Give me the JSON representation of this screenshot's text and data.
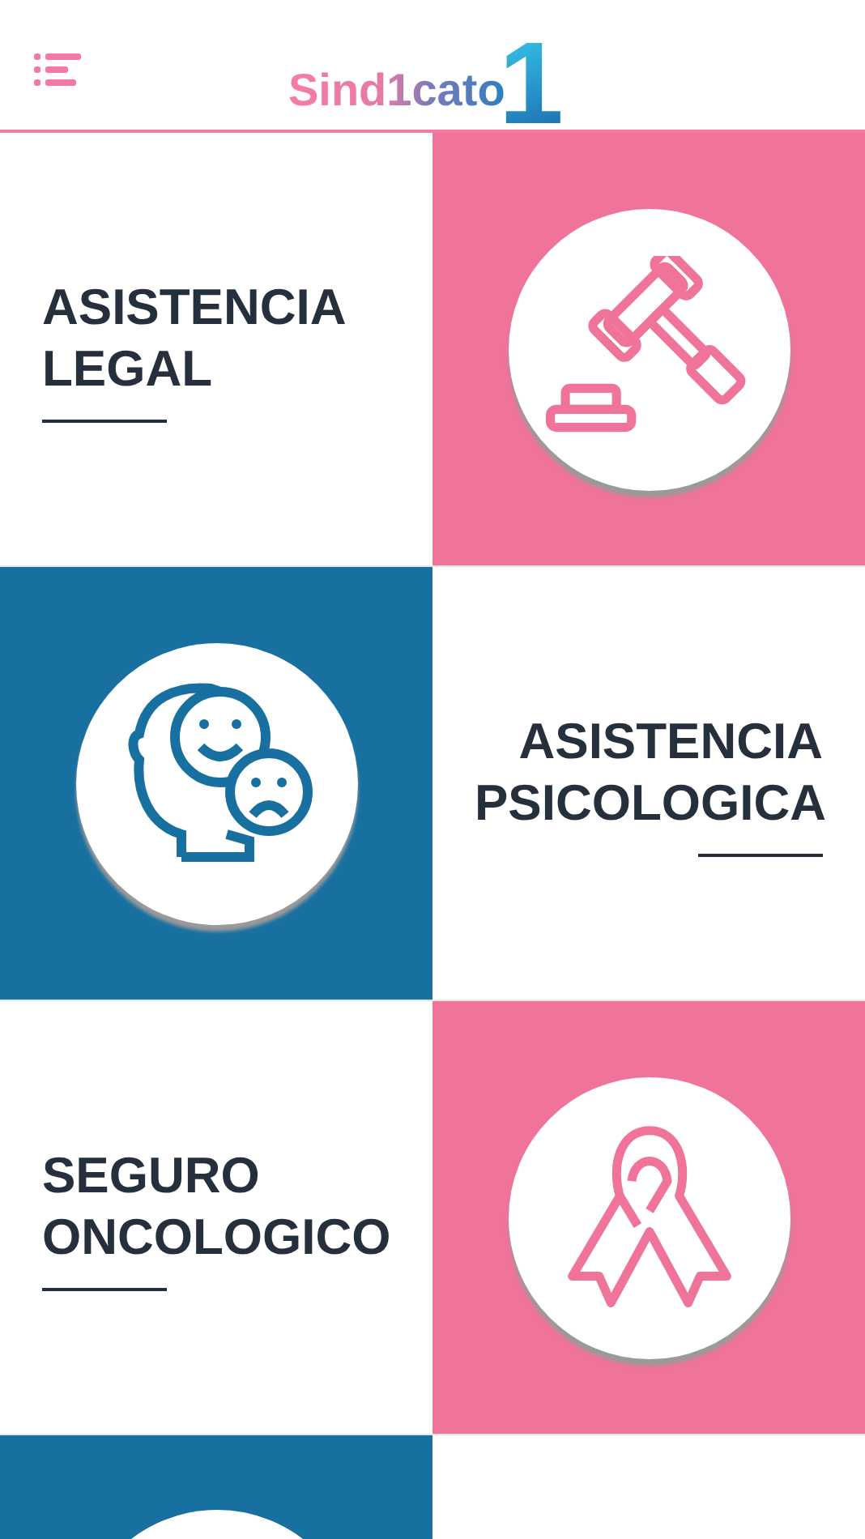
{
  "header": {
    "logo_text": "Sind1cato",
    "logo_mark": "1"
  },
  "sections": [
    {
      "title": "ASISTENCIA LEGAL",
      "text_left": true,
      "color": "#f07399",
      "kind": "gavel"
    },
    {
      "title": "ASISTENCIA PSICOLOGICA",
      "text_left": false,
      "color": "#17709f",
      "kind": "head"
    },
    {
      "title": "SEGURO ONCOLOGICO",
      "text_left": true,
      "color": "#f07399",
      "kind": "ribbon"
    },
    {
      "text_left": false,
      "color": "#17709f",
      "kind": "disc"
    }
  ]
}
